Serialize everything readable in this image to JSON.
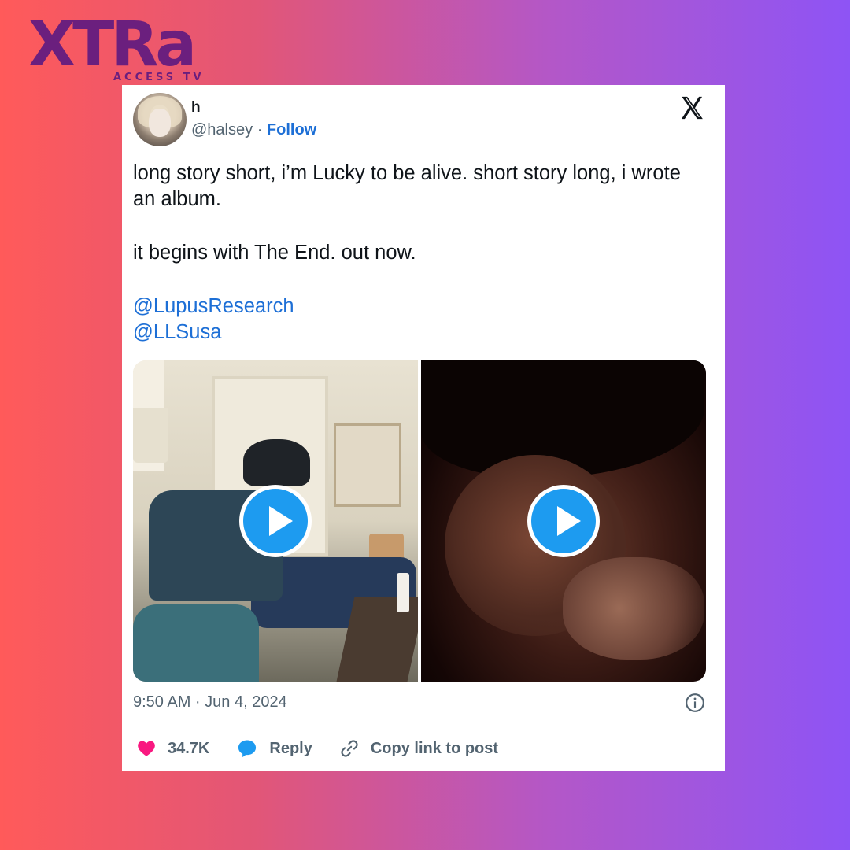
{
  "brand": {
    "name": "XTRa",
    "tagline": "ACCESS TV"
  },
  "tweet": {
    "display_name": "h",
    "handle": "@halsey",
    "separator": "·",
    "follow_label": "Follow",
    "lines": {
      "p1": "long story short, i’m Lucky to be alive. short story long, i wrote an album.",
      "p2": "it begins with The End. out now."
    },
    "mentions": [
      "@LupusResearch",
      "@LLSusa"
    ],
    "timestamp": "9:50 AM · Jun 4, 2024",
    "likes": "34.7K",
    "reply_label": "Reply",
    "copy_label": "Copy link to post"
  },
  "colors": {
    "like": "#f91880",
    "link": "#1d6fd6",
    "play": "#1d9bf0"
  },
  "icons": [
    "x-logo-icon",
    "heart-icon",
    "speech-bubble-icon",
    "link-icon",
    "info-icon",
    "play-icon"
  ]
}
